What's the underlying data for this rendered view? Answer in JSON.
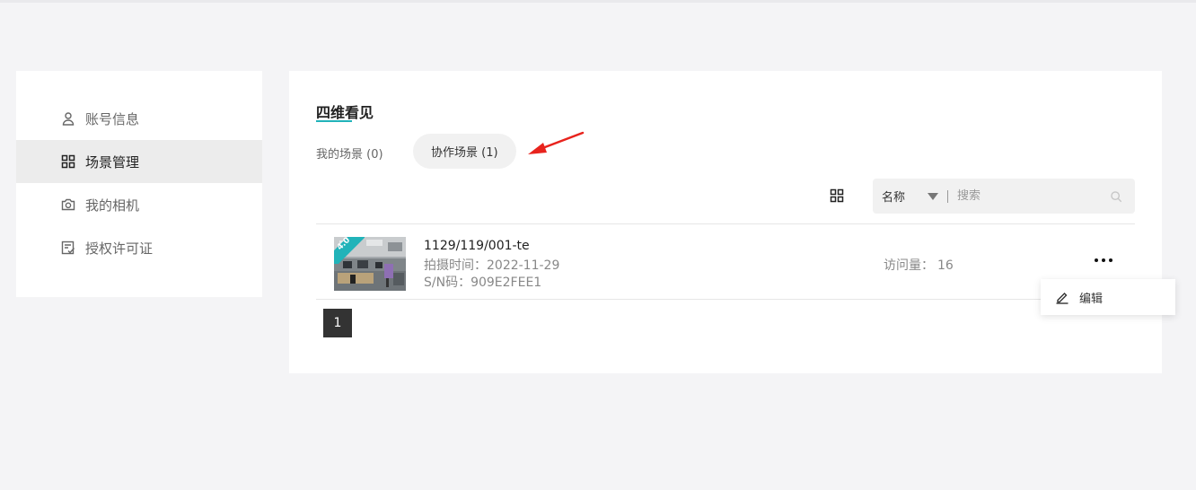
{
  "sidebar": {
    "items": [
      {
        "label": "账号信息",
        "icon": "user-icon",
        "active": false
      },
      {
        "label": "场景管理",
        "icon": "grid-icon",
        "active": true
      },
      {
        "label": "我的相机",
        "icon": "camera-icon",
        "active": false
      },
      {
        "label": "授权许可证",
        "icon": "license-icon",
        "active": false
      }
    ]
  },
  "main": {
    "title": "四维看见",
    "tabs": [
      {
        "label": "我的场景 (0)",
        "active": false
      },
      {
        "label": "协作场景 (1)",
        "active": true
      }
    ],
    "search": {
      "field_select": "名称",
      "placeholder": "搜索"
    },
    "scenes": [
      {
        "name": "1129/119/001-te",
        "capture_time": "拍摄时间：2022-11-29",
        "sn": "S/N码：909E2FEE1",
        "views_label": "访问量：",
        "views_value": "16",
        "badge": "4.0"
      }
    ],
    "pagination": {
      "current": "1"
    }
  },
  "dropdown": {
    "items": [
      {
        "label": "编辑",
        "icon": "pencil-icon"
      }
    ]
  },
  "colors": {
    "accent": "#21b3b9",
    "arrow": "#e8231d",
    "active_bg": "#ececec"
  }
}
